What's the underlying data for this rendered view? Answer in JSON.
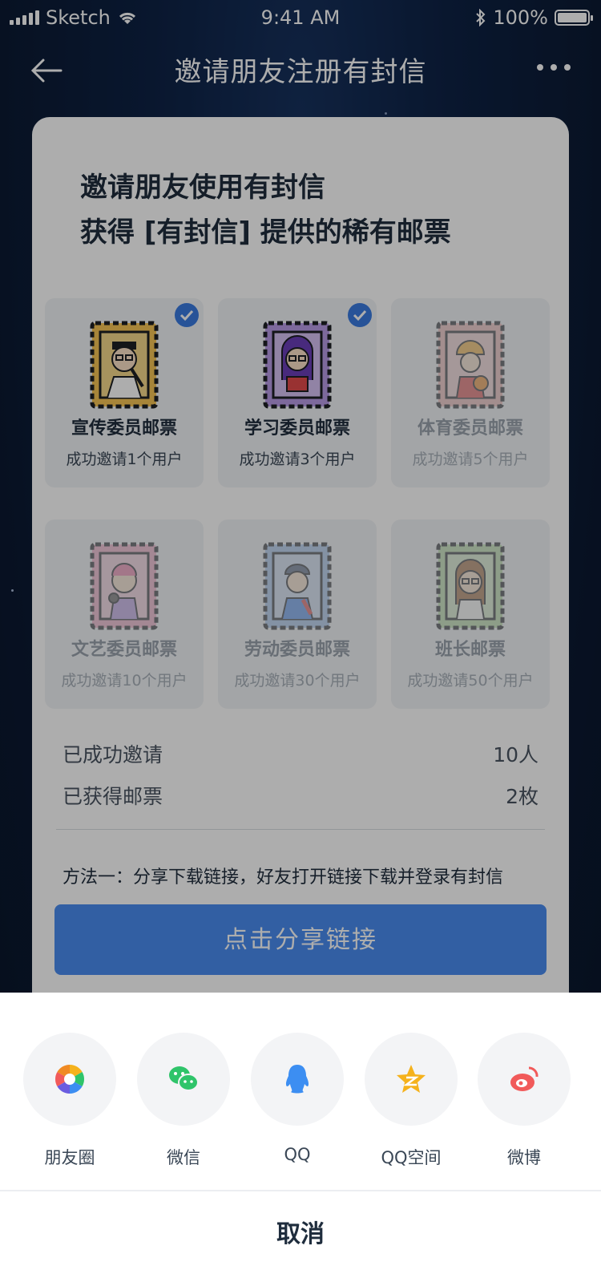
{
  "status_bar": {
    "carrier": "Sketch",
    "time": "9:41 AM",
    "battery": "100%"
  },
  "nav": {
    "title": "邀请朋友注册有封信"
  },
  "card": {
    "headline_line1": "邀请朋友使用有封信",
    "headline_line2": "获得 [有封信] 提供的稀有邮票",
    "stamps": [
      {
        "name": "宣传委员邮票",
        "requirement": "成功邀请1个用户",
        "obtained": true,
        "icon": "propaganda-stamp-icon"
      },
      {
        "name": "学习委员邮票",
        "requirement": "成功邀请3个用户",
        "obtained": true,
        "icon": "study-stamp-icon"
      },
      {
        "name": "体育委员邮票",
        "requirement": "成功邀请5个用户",
        "obtained": false,
        "icon": "sports-stamp-icon"
      },
      {
        "name": "文艺委员邮票",
        "requirement": "成功邀请10个用户",
        "obtained": false,
        "icon": "arts-stamp-icon"
      },
      {
        "name": "劳动委员邮票",
        "requirement": "成功邀请30个用户",
        "obtained": false,
        "icon": "labor-stamp-icon"
      },
      {
        "name": "班长邮票",
        "requirement": "成功邀请50个用户",
        "obtained": false,
        "icon": "monitor-stamp-icon"
      }
    ],
    "stats": {
      "invited_label": "已成功邀请",
      "invited_value": "10人",
      "stamps_label": "已获得邮票",
      "stamps_value": "2枚"
    },
    "method_text": "方法一：分享下载链接，好友打开链接下载并登录有封信",
    "share_button": "点击分享链接"
  },
  "share_sheet": {
    "targets": [
      {
        "label": "朋友圈",
        "icon": "moments-icon"
      },
      {
        "label": "微信",
        "icon": "wechat-icon"
      },
      {
        "label": "QQ",
        "icon": "qq-icon"
      },
      {
        "label": "QQ空间",
        "icon": "qzone-icon"
      },
      {
        "label": "微博",
        "icon": "weibo-icon"
      }
    ],
    "cancel": "取消"
  },
  "colors": {
    "accent": "#4a8df0",
    "check": "#3a7be0",
    "wechat": "#2fc46a",
    "qq": "#3c8ef2",
    "qzone": "#f5b21c",
    "weibo": "#f15a5a"
  }
}
